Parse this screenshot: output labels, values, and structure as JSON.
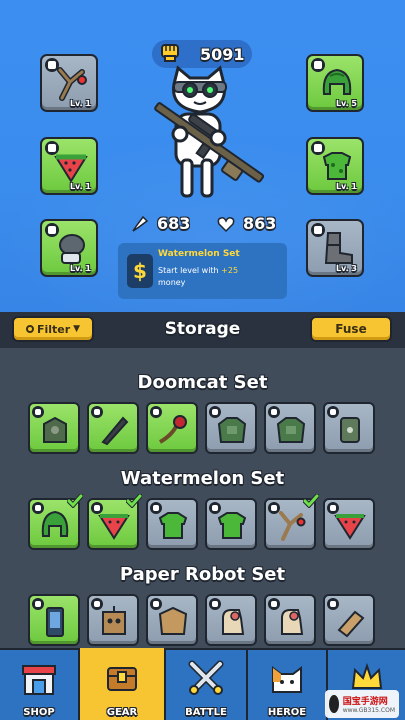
{
  "hero": {
    "power": "5091",
    "attack": "683",
    "health": "863",
    "set_bonus": {
      "title": "Watermelon Set",
      "desc_prefix": "Start level with ",
      "desc_value": "+25",
      "desc_suffix": "money"
    },
    "slots_left": [
      {
        "icon": "slingshot-icon",
        "level": "Lv. 1",
        "rarity": "gray"
      },
      {
        "icon": "watermelon-slice-icon",
        "level": "Lv. 1",
        "rarity": "green"
      },
      {
        "icon": "grenade-glove-icon",
        "level": "Lv. 1",
        "rarity": "green"
      }
    ],
    "slots_right": [
      {
        "icon": "helmet-icon",
        "level": "Lv. 5",
        "rarity": "green"
      },
      {
        "icon": "armor-icon",
        "level": "Lv. 1",
        "rarity": "green"
      },
      {
        "icon": "boot-icon",
        "level": "Lv. 3",
        "rarity": "gray"
      }
    ]
  },
  "storage_bar": {
    "filter_label": "Filter",
    "title": "Storage",
    "fuse_label": "Fuse"
  },
  "sets": [
    {
      "title": "Doomcat Set",
      "items": [
        {
          "icon": "doom-armor-icon",
          "rarity": "green"
        },
        {
          "icon": "knife-icon",
          "rarity": "green"
        },
        {
          "icon": "rose-whip-icon",
          "rarity": "green"
        },
        {
          "icon": "doom-chest-icon",
          "rarity": "gray"
        },
        {
          "icon": "doom-chest-icon",
          "rarity": "gray"
        },
        {
          "icon": "doom-shield-icon",
          "rarity": "gray"
        }
      ]
    },
    {
      "title": "Watermelon Set",
      "items": [
        {
          "icon": "watermelon-helmet-icon",
          "rarity": "green",
          "equipped": true
        },
        {
          "icon": "watermelon-slice-icon",
          "rarity": "green",
          "equipped": true
        },
        {
          "icon": "watermelon-armor-icon",
          "rarity": "gray"
        },
        {
          "icon": "watermelon-armor-icon",
          "rarity": "gray"
        },
        {
          "icon": "slingshot-icon",
          "rarity": "gray",
          "equipped": true
        },
        {
          "icon": "watermelon-slice-icon",
          "rarity": "gray"
        }
      ]
    },
    {
      "title": "Paper Robot Set",
      "items": [
        {
          "icon": "phone-icon",
          "rarity": "green"
        },
        {
          "icon": "box-robot-icon",
          "rarity": "gray"
        },
        {
          "icon": "box-helmet-icon",
          "rarity": "gray"
        },
        {
          "icon": "paper-glove-icon",
          "rarity": "gray"
        },
        {
          "icon": "paper-glove-icon",
          "rarity": "gray"
        },
        {
          "icon": "paper-arm-icon",
          "rarity": "gray"
        }
      ]
    }
  ],
  "nav": [
    {
      "label": "SHOP",
      "icon": "shop-icon",
      "active": false
    },
    {
      "label": "GEAR",
      "icon": "chest-icon",
      "active": true
    },
    {
      "label": "BATTLE",
      "icon": "crossed-swords-icon",
      "active": false
    },
    {
      "label": "HEROE",
      "icon": "cat-face-icon",
      "active": false
    },
    {
      "label": "",
      "icon": "crown-icon",
      "active": false
    }
  ],
  "watermark": {
    "line1": "国宝手游网",
    "line2": "www.GB315.COM"
  },
  "colors": {
    "sky": "#3c8ff0",
    "panel": "#414c5a",
    "bar": "#2a3240",
    "accent_yellow": "#f7c531",
    "rarity_green": "#7fd54f",
    "rarity_gray": "#9aaabc"
  }
}
